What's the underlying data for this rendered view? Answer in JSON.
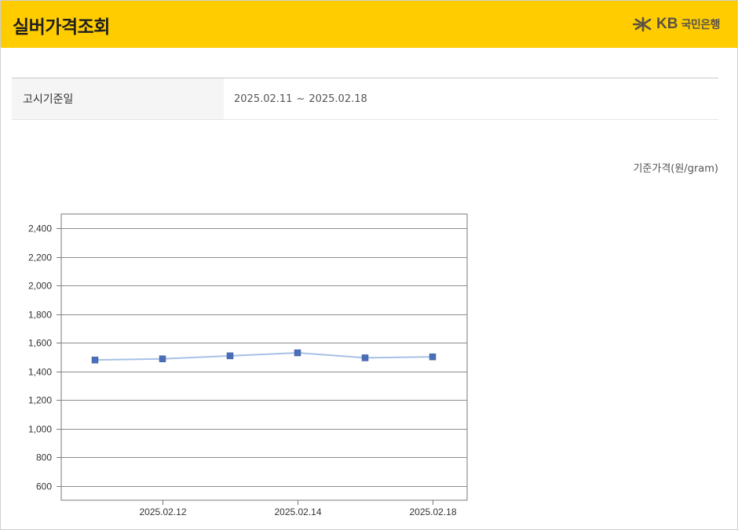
{
  "header": {
    "title": "실버가격조회",
    "brand": {
      "kb": "KB",
      "name": "국민은행",
      "icon": "kb-star-logo-icon",
      "color": "#5a5246"
    },
    "background_color": "#ffcc00"
  },
  "info": {
    "label": "고시기준일",
    "start_date": "2025.02.11",
    "separator": "~",
    "end_date": "2025.02.18"
  },
  "unit_label": "기준가격(원/gram)",
  "chart_data": {
    "type": "line",
    "x": [
      "2025.02.11",
      "2025.02.12",
      "2025.02.13",
      "2025.02.14",
      "2025.02.17",
      "2025.02.18"
    ],
    "xticks": [
      "2025.02.12",
      "2025.02.14",
      "2025.02.18"
    ],
    "series": [
      {
        "values": [
          1480,
          1488,
          1509,
          1530,
          1495,
          1502
        ],
        "color": "#4a6fb8"
      }
    ],
    "ylim": [
      500,
      2500
    ],
    "yticks": [
      600,
      800,
      1000,
      1200,
      1400,
      1600,
      1800,
      2000,
      2200,
      2400
    ],
    "ytick_labels": [
      "600",
      "800",
      "1,000",
      "1,200",
      "1,400",
      "1,600",
      "1,800",
      "2,000",
      "2,200",
      "2,400"
    ],
    "grid": true,
    "line_color": "#a8c0e6"
  }
}
